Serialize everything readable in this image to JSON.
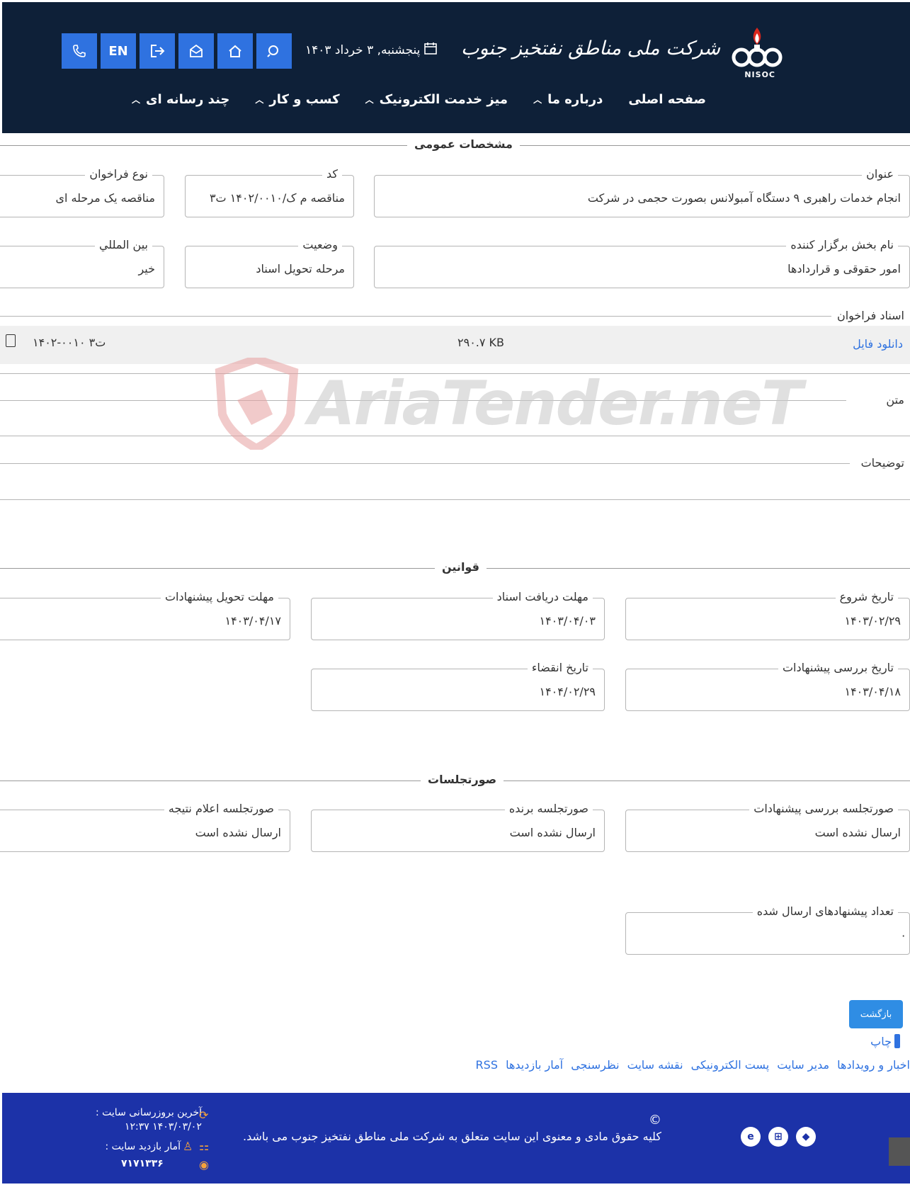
{
  "header": {
    "logo_text": "شرکت ملی مناطق نفتخیز جنوب",
    "logo_abbr": "NISOC",
    "date": "پنجشنبه, ۳ خرداد ۱۴۰۳",
    "lang_label": "EN",
    "menu": [
      {
        "label": "صفحه اصلی"
      },
      {
        "label": "درباره ما"
      },
      {
        "label": "میز خدمت الکترونیک"
      },
      {
        "label": "کسب و کار"
      },
      {
        "label": "چند رسانه ای"
      }
    ]
  },
  "general": {
    "title": "مشخصات عمومی",
    "subject_label": "عنوان",
    "subject_value": "انجام خدمات راهبری ۹ دستگاه آمبولانس بصورت حجمی در شرکت",
    "code_label": "کد",
    "code_value": "مناقصه م ک/۱۴۰۲/۰۰۱۰ ت۳",
    "type_label": "نوع فراخوان",
    "type_value": "مناقصه یک مرحله ای",
    "dept_label": "نام بخش برگزار کننده",
    "dept_value": "امور حقوقی و قراردادها",
    "status_label": "وضعیت",
    "status_value": "مرحله تحویل اسناد",
    "intl_label": "بین المللي",
    "intl_value": "خیر",
    "docs_label": "اسناد فراخوان",
    "download_label": "دانلود فایل",
    "file_size": "۲۹۰.۷ KB",
    "file_name": "ت۳ ۰۰۱۰-۱۴۰۲",
    "text_label": "متن",
    "desc_label": "توضیحات"
  },
  "watermark": "AriaTender.neT",
  "rules": {
    "title": "قوانین",
    "start_label": "تاریخ شروع",
    "start_value": "۱۴۰۳/۰۲/۲۹",
    "receive_label": "مهلت دریافت اسناد",
    "receive_value": "۱۴۰۳/۰۴/۰۳",
    "submit_label": "مهلت تحویل پیشنهادات",
    "submit_value": "۱۴۰۳/۰۴/۱۷",
    "review_label": "تاریخ بررسی پیشنهادات",
    "review_value": "۱۴۰۳/۰۴/۱۸",
    "expire_label": "تاریخ انقضاء",
    "expire_value": "۱۴۰۴/۰۲/۲۹"
  },
  "minutes": {
    "title": "صورتجلسات",
    "review_label": "صورتجلسه بررسی پیشنهادات",
    "review_value": "ارسال نشده است",
    "winner_label": "صورتجلسه برنده",
    "winner_value": "ارسال نشده است",
    "result_label": "صورتجلسه اعلام نتیجه",
    "result_value": "ارسال نشده است",
    "count_label": "تعداد پیشنهادهای ارسال شده",
    "count_value": "۰"
  },
  "actions": {
    "back_label": "بازگشت",
    "print_label": "چاپ",
    "links": [
      "اخبار و رویدادها",
      "مدیر سایت",
      "پست الکترونیکی",
      "نقشه سایت",
      "نظرسنجی",
      "آمار بازدیدها",
      "RSS"
    ]
  },
  "footer": {
    "copyright_symbol": "©",
    "copyright": "کلیه حقوق مادی و معنوی این سایت متعلق به شرکت ملی مناطق نفتخیز جنوب می باشد.",
    "update_label": "آخرین بروزرسانی سایت :",
    "update_value": "۱۴۰۳/۰۳/۰۲ ۱۲:۳۷",
    "visits_label": "آمار بازدید سایت :",
    "visits_value": "۷۱۷۱۳۳۶"
  }
}
